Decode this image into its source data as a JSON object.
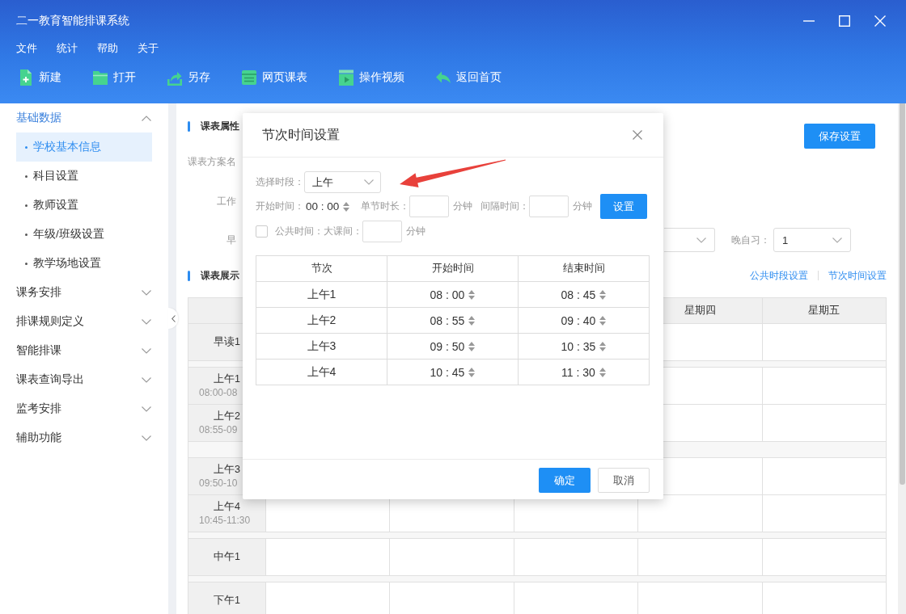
{
  "window": {
    "title": "二一教育智能排课系统"
  },
  "menu": [
    "文件",
    "统计",
    "帮助",
    "关于"
  ],
  "toolbar": [
    {
      "label": "新建",
      "kind": "new"
    },
    {
      "label": "打开",
      "kind": "open"
    },
    {
      "label": "另存",
      "kind": "export"
    },
    {
      "label": "网页课表",
      "kind": "table"
    },
    {
      "label": "操作视频",
      "kind": "video"
    },
    {
      "label": "返回首页",
      "kind": "back"
    }
  ],
  "sidebar": {
    "items": [
      {
        "label": "基础数据",
        "expanded": true,
        "children": [
          {
            "label": "学校基本信息",
            "selected": true
          },
          {
            "label": "科目设置",
            "selected": false
          },
          {
            "label": "教师设置",
            "selected": false
          },
          {
            "label": "年级/班级设置",
            "selected": false
          },
          {
            "label": "教学场地设置",
            "selected": false
          }
        ]
      },
      {
        "label": "课务安排",
        "expanded": false
      },
      {
        "label": "排课规则定义",
        "expanded": false
      },
      {
        "label": "智能排课",
        "expanded": false
      },
      {
        "label": "课表查询导出",
        "expanded": false
      },
      {
        "label": "监考安排",
        "expanded": false
      },
      {
        "label": "辅助功能",
        "expanded": false
      }
    ]
  },
  "properties": {
    "title": "课表属性",
    "save_button": "保存设置",
    "name_label": "课表方案名",
    "workdays_label": "工作",
    "morning_label": "早",
    "evening_label": "晚自习：",
    "evening_value": "1"
  },
  "timetable": {
    "title": "课表展示",
    "links": [
      "公共时段设置",
      "节次时间设置"
    ],
    "columns": [
      "星期四",
      "星期五"
    ],
    "rows": [
      {
        "kind": "period",
        "label": "早读1"
      },
      {
        "kind": "gap"
      },
      {
        "kind": "period",
        "label": "上午1",
        "time": "08:00-08"
      },
      {
        "kind": "period",
        "label": "上午2",
        "time": "08:55-09"
      },
      {
        "kind": "widegap"
      },
      {
        "kind": "period",
        "label": "上午3",
        "time": "09:50-10"
      },
      {
        "kind": "period",
        "label": "上午4",
        "time": "10:45-11:30"
      },
      {
        "kind": "gap"
      },
      {
        "kind": "period",
        "label": "中午1"
      },
      {
        "kind": "gap"
      },
      {
        "kind": "period",
        "label": "下午1"
      }
    ]
  },
  "dialog": {
    "title": "节次时间设置",
    "segment": {
      "label": "选择时段：",
      "value": "上午"
    },
    "start": {
      "label": "开始时间：",
      "value": "00 : 00"
    },
    "duration": {
      "label": "单节时长：",
      "unit": "分钟"
    },
    "interval": {
      "label": "间隔时间：",
      "unit": "分钟"
    },
    "set_button": "设置",
    "common": {
      "checked": false,
      "label": "公共时间：",
      "break_label": "大课间：",
      "unit": "分钟"
    },
    "table": {
      "columns": [
        "节次",
        "开始时间",
        "结束时间"
      ],
      "rows": [
        {
          "period": "上午1",
          "start": "08 : 00",
          "end": "08 : 45"
        },
        {
          "period": "上午2",
          "start": "08 : 55",
          "end": "09 : 40"
        },
        {
          "period": "上午3",
          "start": "09 : 50",
          "end": "10 : 35"
        },
        {
          "period": "上午4",
          "start": "10 : 45",
          "end": "11 : 30"
        }
      ]
    },
    "buttons": [
      {
        "label": "确定",
        "kind": "primary"
      },
      {
        "label": "取消",
        "kind": "plain"
      }
    ]
  }
}
